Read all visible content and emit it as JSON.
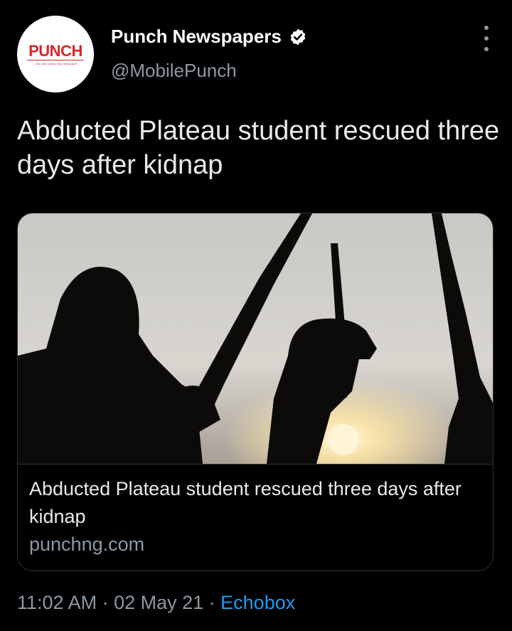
{
  "author": {
    "avatar_logo": "PUNCH",
    "avatar_tagline": "...the most widely read newspaper",
    "name": "Punch Newspapers",
    "handle": "@MobilePunch",
    "verified": true
  },
  "tweet": {
    "text": "Abducted Plateau student rescued three days after kidnap"
  },
  "card": {
    "title": "Abducted Plateau student rescued three days after kidnap",
    "domain": "punchng.com"
  },
  "meta": {
    "time": "11:02 AM",
    "sep1": " · ",
    "date": "02 May 21",
    "sep2": " · ",
    "source": "Echobox"
  },
  "colors": {
    "background": "#000000",
    "link": "#1d9bf0",
    "secondary_text": "#8b98a5",
    "brand_red": "#d9252a"
  },
  "icons": [
    "verified-badge-icon",
    "more-options-icon"
  ]
}
